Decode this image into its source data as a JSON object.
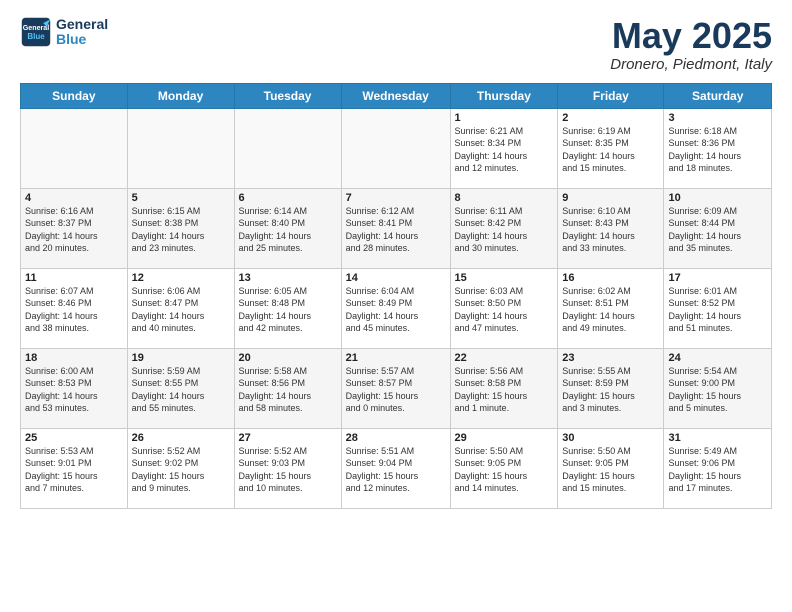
{
  "logo": {
    "line1": "General",
    "line2": "Blue"
  },
  "title": "May 2025",
  "location": "Dronero, Piedmont, Italy",
  "weekdays": [
    "Sunday",
    "Monday",
    "Tuesday",
    "Wednesday",
    "Thursday",
    "Friday",
    "Saturday"
  ],
  "weeks": [
    [
      {
        "day": "",
        "info": ""
      },
      {
        "day": "",
        "info": ""
      },
      {
        "day": "",
        "info": ""
      },
      {
        "day": "",
        "info": ""
      },
      {
        "day": "1",
        "info": "Sunrise: 6:21 AM\nSunset: 8:34 PM\nDaylight: 14 hours\nand 12 minutes."
      },
      {
        "day": "2",
        "info": "Sunrise: 6:19 AM\nSunset: 8:35 PM\nDaylight: 14 hours\nand 15 minutes."
      },
      {
        "day": "3",
        "info": "Sunrise: 6:18 AM\nSunset: 8:36 PM\nDaylight: 14 hours\nand 18 minutes."
      }
    ],
    [
      {
        "day": "4",
        "info": "Sunrise: 6:16 AM\nSunset: 8:37 PM\nDaylight: 14 hours\nand 20 minutes."
      },
      {
        "day": "5",
        "info": "Sunrise: 6:15 AM\nSunset: 8:38 PM\nDaylight: 14 hours\nand 23 minutes."
      },
      {
        "day": "6",
        "info": "Sunrise: 6:14 AM\nSunset: 8:40 PM\nDaylight: 14 hours\nand 25 minutes."
      },
      {
        "day": "7",
        "info": "Sunrise: 6:12 AM\nSunset: 8:41 PM\nDaylight: 14 hours\nand 28 minutes."
      },
      {
        "day": "8",
        "info": "Sunrise: 6:11 AM\nSunset: 8:42 PM\nDaylight: 14 hours\nand 30 minutes."
      },
      {
        "day": "9",
        "info": "Sunrise: 6:10 AM\nSunset: 8:43 PM\nDaylight: 14 hours\nand 33 minutes."
      },
      {
        "day": "10",
        "info": "Sunrise: 6:09 AM\nSunset: 8:44 PM\nDaylight: 14 hours\nand 35 minutes."
      }
    ],
    [
      {
        "day": "11",
        "info": "Sunrise: 6:07 AM\nSunset: 8:46 PM\nDaylight: 14 hours\nand 38 minutes."
      },
      {
        "day": "12",
        "info": "Sunrise: 6:06 AM\nSunset: 8:47 PM\nDaylight: 14 hours\nand 40 minutes."
      },
      {
        "day": "13",
        "info": "Sunrise: 6:05 AM\nSunset: 8:48 PM\nDaylight: 14 hours\nand 42 minutes."
      },
      {
        "day": "14",
        "info": "Sunrise: 6:04 AM\nSunset: 8:49 PM\nDaylight: 14 hours\nand 45 minutes."
      },
      {
        "day": "15",
        "info": "Sunrise: 6:03 AM\nSunset: 8:50 PM\nDaylight: 14 hours\nand 47 minutes."
      },
      {
        "day": "16",
        "info": "Sunrise: 6:02 AM\nSunset: 8:51 PM\nDaylight: 14 hours\nand 49 minutes."
      },
      {
        "day": "17",
        "info": "Sunrise: 6:01 AM\nSunset: 8:52 PM\nDaylight: 14 hours\nand 51 minutes."
      }
    ],
    [
      {
        "day": "18",
        "info": "Sunrise: 6:00 AM\nSunset: 8:53 PM\nDaylight: 14 hours\nand 53 minutes."
      },
      {
        "day": "19",
        "info": "Sunrise: 5:59 AM\nSunset: 8:55 PM\nDaylight: 14 hours\nand 55 minutes."
      },
      {
        "day": "20",
        "info": "Sunrise: 5:58 AM\nSunset: 8:56 PM\nDaylight: 14 hours\nand 58 minutes."
      },
      {
        "day": "21",
        "info": "Sunrise: 5:57 AM\nSunset: 8:57 PM\nDaylight: 15 hours\nand 0 minutes."
      },
      {
        "day": "22",
        "info": "Sunrise: 5:56 AM\nSunset: 8:58 PM\nDaylight: 15 hours\nand 1 minute."
      },
      {
        "day": "23",
        "info": "Sunrise: 5:55 AM\nSunset: 8:59 PM\nDaylight: 15 hours\nand 3 minutes."
      },
      {
        "day": "24",
        "info": "Sunrise: 5:54 AM\nSunset: 9:00 PM\nDaylight: 15 hours\nand 5 minutes."
      }
    ],
    [
      {
        "day": "25",
        "info": "Sunrise: 5:53 AM\nSunset: 9:01 PM\nDaylight: 15 hours\nand 7 minutes."
      },
      {
        "day": "26",
        "info": "Sunrise: 5:52 AM\nSunset: 9:02 PM\nDaylight: 15 hours\nand 9 minutes."
      },
      {
        "day": "27",
        "info": "Sunrise: 5:52 AM\nSunset: 9:03 PM\nDaylight: 15 hours\nand 10 minutes."
      },
      {
        "day": "28",
        "info": "Sunrise: 5:51 AM\nSunset: 9:04 PM\nDaylight: 15 hours\nand 12 minutes."
      },
      {
        "day": "29",
        "info": "Sunrise: 5:50 AM\nSunset: 9:05 PM\nDaylight: 15 hours\nand 14 minutes."
      },
      {
        "day": "30",
        "info": "Sunrise: 5:50 AM\nSunset: 9:05 PM\nDaylight: 15 hours\nand 15 minutes."
      },
      {
        "day": "31",
        "info": "Sunrise: 5:49 AM\nSunset: 9:06 PM\nDaylight: 15 hours\nand 17 minutes."
      }
    ]
  ]
}
